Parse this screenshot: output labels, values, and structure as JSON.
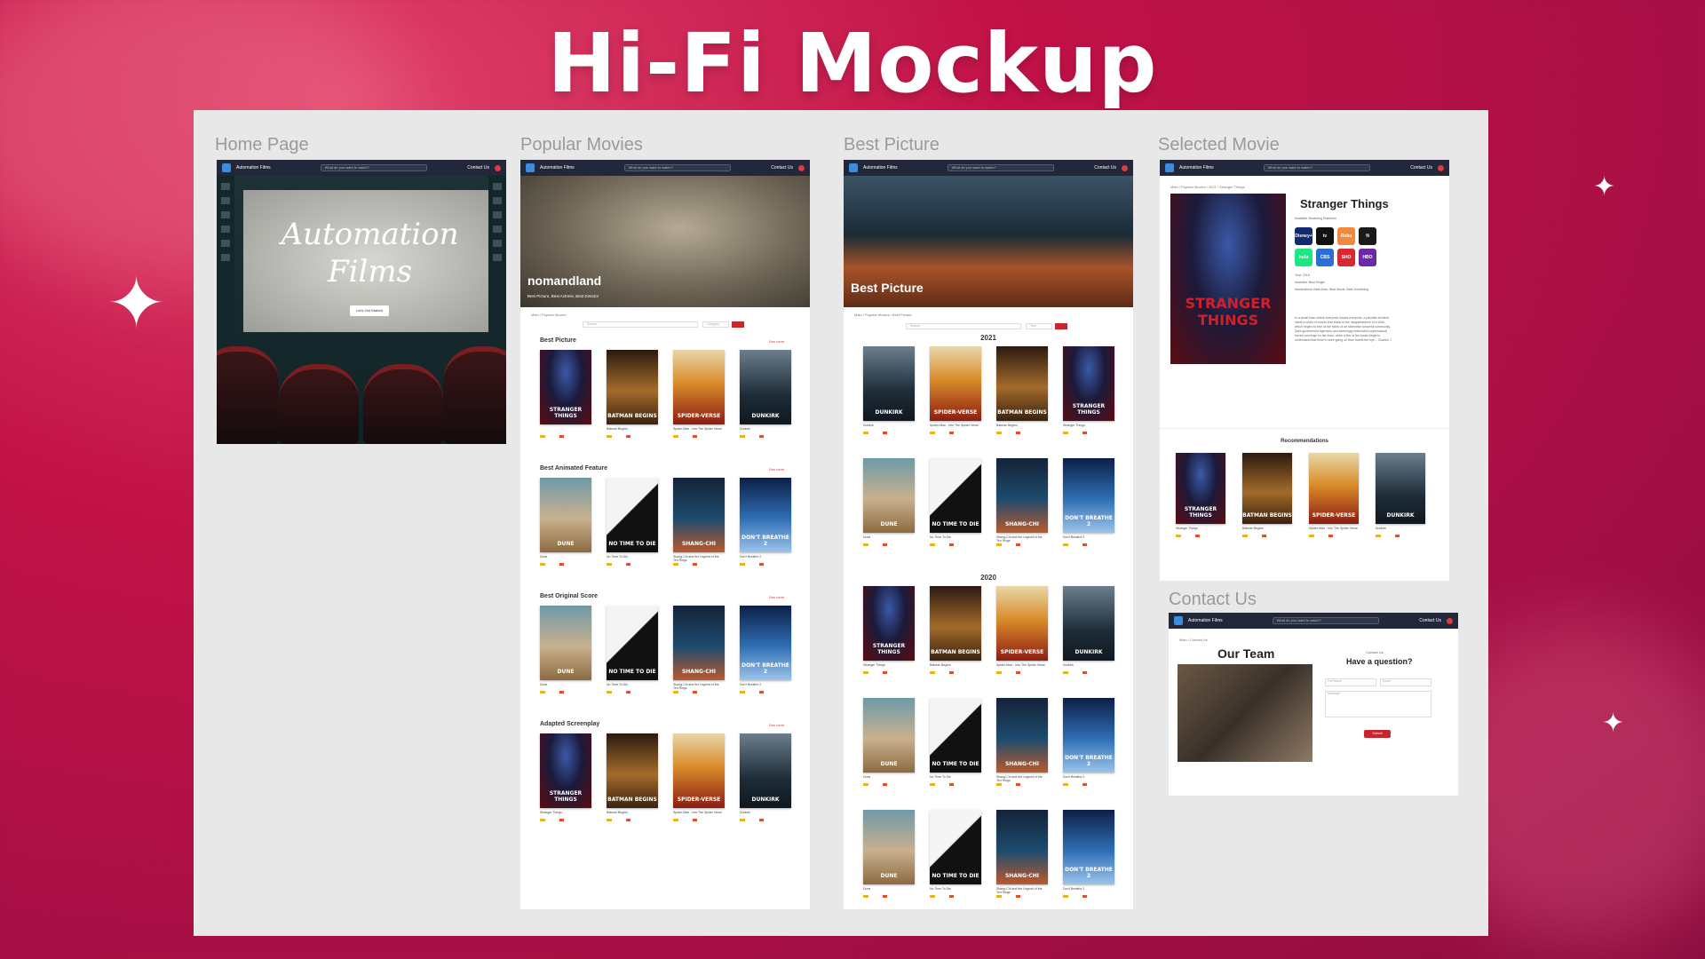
{
  "title": "Hi-Fi Mockup",
  "frames": {
    "home": {
      "label": "Home Page"
    },
    "popular": {
      "label": "Popular Movies"
    },
    "best": {
      "label": "Best Picture"
    },
    "selected": {
      "label": "Selected Movie"
    },
    "contact": {
      "label": "Contact Us"
    }
  },
  "navbar": {
    "brand": "Automation Films",
    "search_placeholder": "What do you want to watch?",
    "contact_label": "Contact Us"
  },
  "home": {
    "hero_line1": "Automation",
    "hero_line2": "Films",
    "cta": "Let's Get Started"
  },
  "popular": {
    "hero_title": "nomandland",
    "hero_sub": "Best Picture, Best Actress, Best Director",
    "breadcrumb": "Main / Popular Movies",
    "search_placeholder": "Search",
    "category_label": "Category",
    "see_all": "See more",
    "sections": [
      {
        "title": "Best Picture",
        "posters": [
          "stranger",
          "batman",
          "spider",
          "dunkirk"
        ],
        "captions": [
          "",
          "Batman Begins",
          "Spider-Man - Into The Spider Verse",
          "Dunkirk"
        ]
      },
      {
        "title": "Best Animated Feature",
        "posters": [
          "dune",
          "bond",
          "shang",
          "frozen"
        ],
        "captions": [
          "Dune",
          "No Time To Die",
          "Shang-Chi and the Legend of the Ten Rings",
          "Don't Breathe 2"
        ]
      },
      {
        "title": "Best Original Score",
        "posters": [
          "dune",
          "bond",
          "shang",
          "frozen"
        ],
        "captions": [
          "Dune",
          "No Time To Die",
          "Shang-Chi and the Legend of the Ten Rings",
          "Don't Breathe 2"
        ]
      },
      {
        "title": "Adapted Screenplay",
        "posters": [
          "stranger",
          "batman",
          "spider",
          "dunkirk"
        ],
        "captions": [
          "Stranger Things",
          "Batman Begins",
          "Spider-Man - Into The Spider Verse",
          "Dunkirk"
        ]
      }
    ]
  },
  "best": {
    "hero_title": "Best Picture",
    "breadcrumb": "Main / Popular Movies / Best Picture",
    "search_placeholder": "Search",
    "year_label": "Year",
    "years": [
      {
        "year": "2021",
        "rows": [
          {
            "posters": [
              "dunkirk",
              "spider",
              "batman",
              "stranger"
            ],
            "captions": [
              "Dunkirk",
              "Spider-Man - Into The Spider Verse",
              "Batman Begins",
              "Stranger Things"
            ]
          },
          {
            "posters": [
              "dune",
              "bond",
              "shang",
              "frozen"
            ],
            "captions": [
              "Dune",
              "No Time To Die",
              "Shang-Chi and the Legend of the Ten Rings",
              "Don't Breathe 2"
            ]
          }
        ]
      },
      {
        "year": "2020",
        "rows": [
          {
            "posters": [
              "stranger",
              "batman",
              "spider",
              "dunkirk"
            ],
            "captions": [
              "Stranger Things",
              "Batman Begins",
              "Spider-Man - Into The Spider Verse",
              "Dunkirk"
            ]
          },
          {
            "posters": [
              "dune",
              "bond",
              "shang",
              "frozen"
            ],
            "captions": [
              "Dune",
              "No Time To Die",
              "Shang-Chi and the Legend of the Ten Rings",
              "Don't Breathe 2"
            ]
          },
          {
            "posters": [
              "dune",
              "bond",
              "shang",
              "frozen"
            ],
            "captions": [
              "Dune",
              "No Time To Die",
              "Shang-Chi and the Legend of the Ten Rings",
              "Don't Breathe 2"
            ]
          }
        ]
      }
    ]
  },
  "selected": {
    "breadcrumb": "Main / Popular Movies / 2021 / Stranger Things",
    "title": "Stranger Things",
    "streaming_label": "Available Streaming Platforms",
    "platforms": [
      {
        "name": "Disney+",
        "color": "#0f2a6e"
      },
      {
        "name": "tv",
        "color": "#111111"
      },
      {
        "name": "Roku",
        "color": "#f08a3c"
      },
      {
        "name": "N",
        "color": "#1a1a1a"
      },
      {
        "name": "hulu",
        "color": "#1ce783"
      },
      {
        "name": "CBS",
        "color": "#2a6fd4"
      },
      {
        "name": "SHO",
        "color": "#d9262f"
      },
      {
        "name": "HBO max",
        "color": "#6a2aa8"
      }
    ],
    "year": "Year: 2016",
    "awarded": "Awarded: Best Singer",
    "nominations": "Nominations: Best Actor, Best Movie, Best Something",
    "synopsis": "In a small town where everyone knows everyone, a peculiar incident starts a chain of events that leads to the disappearance of a child, which begins to tear at the fabric of an otherwise peaceful community. Dark government agencies and seemingly malevolent supernatural forces converge on the town, while a few of the locals begin to understand that there's more going on than meets the eye. - Charles J",
    "recommendations_label": "Recommendations",
    "rec_posters": [
      "stranger",
      "batman",
      "spider",
      "dunkirk"
    ],
    "rec_captions": [
      "Stranger Things",
      "Batman Begins",
      "Spider-Man - Into The Spider Verse",
      "Dunkirk"
    ]
  },
  "contact": {
    "breadcrumb": "Main / Contact Us",
    "team_title": "Our Team",
    "kicker": "Contact Us",
    "question": "Have a question?",
    "field_first": "Full Name",
    "field_email": "Email",
    "field_message": "Message",
    "submit": "Submit"
  },
  "poster_titles": {
    "stranger": "STRANGER THINGS",
    "batman": "BATMAN BEGINS",
    "spider": "SPIDER-VERSE",
    "dunkirk": "DUNKIRK",
    "dune": "DUNE",
    "bond": "NO TIME TO DIE",
    "shang": "SHANG-CHI",
    "frozen": "DON'T BREATHE 2"
  }
}
